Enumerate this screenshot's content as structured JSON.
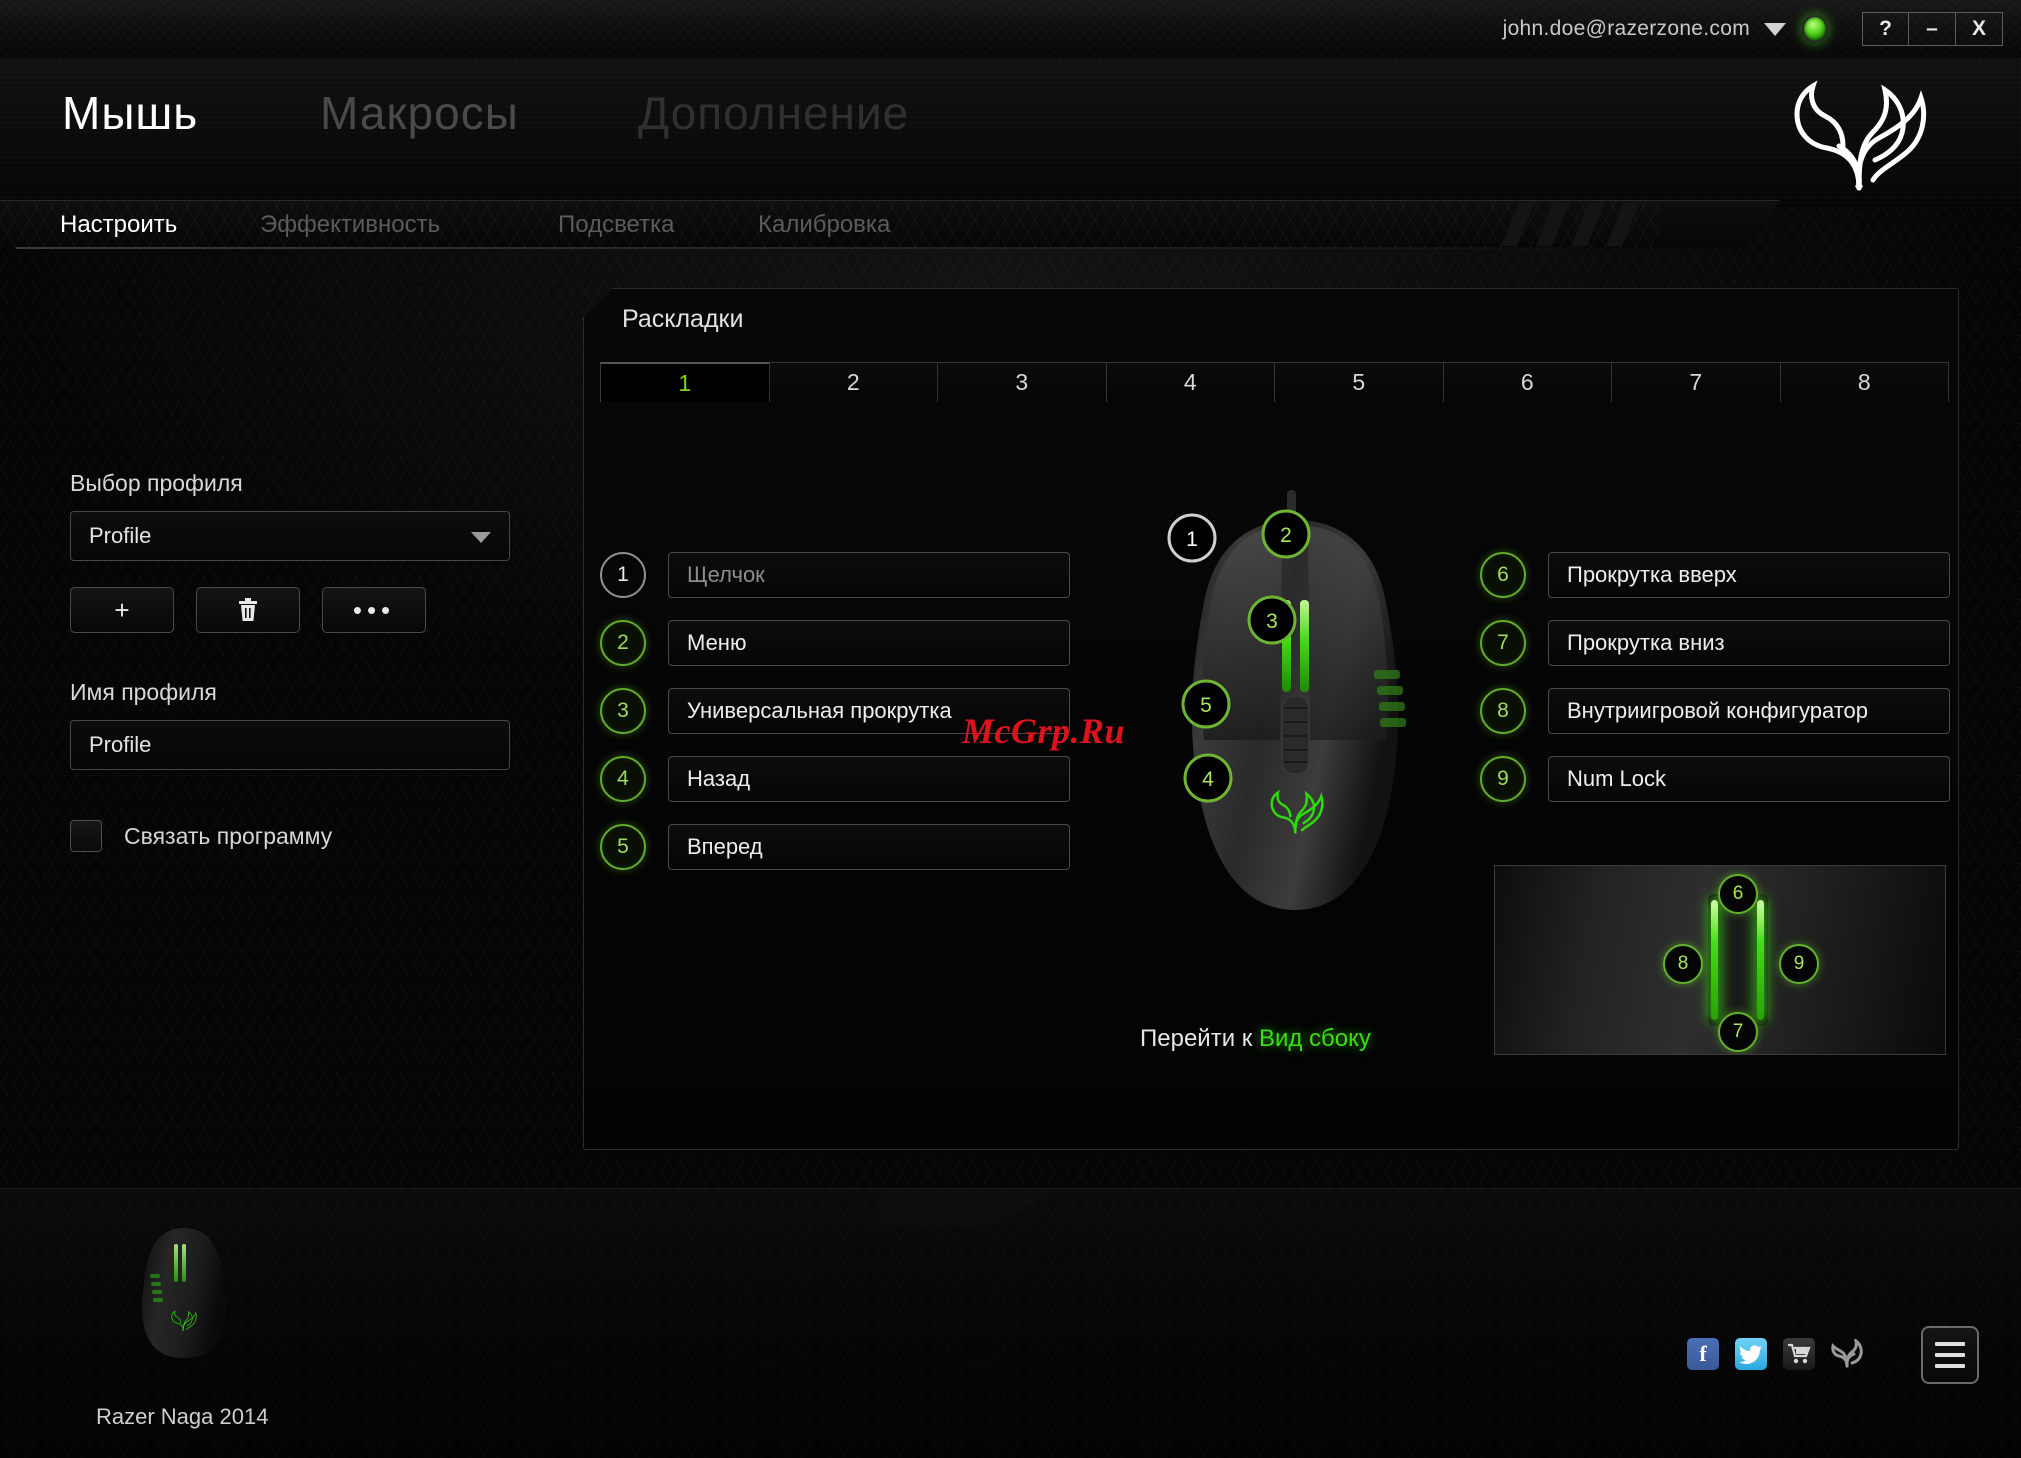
{
  "window": {
    "account_email": "john.doe@razerzone.com",
    "status_indicator": "online",
    "help_label": "?",
    "minimize_label": "–",
    "close_label": "X"
  },
  "main_tabs": [
    {
      "label": "Мышь",
      "active": true
    },
    {
      "label": "Макросы",
      "active": false
    },
    {
      "label": "Дополнение",
      "active": false
    }
  ],
  "sub_tabs": [
    {
      "label": "Настроить",
      "active": true
    },
    {
      "label": "Эффективность",
      "active": false
    },
    {
      "label": "Подсветка",
      "active": false
    },
    {
      "label": "Калибровка",
      "active": false
    }
  ],
  "sidebar": {
    "profile_select_label": "Выбор профиля",
    "profile_select_value": "Profile",
    "add_button": "+",
    "delete_button": "Ὕ1",
    "more_button": "•••",
    "profile_name_label": "Имя профиля",
    "profile_name_value": "Profile",
    "link_program_label": "Связать программу",
    "link_program_checked": false
  },
  "panel": {
    "title": "Раскладки",
    "number_tabs": [
      "1",
      "2",
      "3",
      "4",
      "5",
      "6",
      "7",
      "8"
    ],
    "active_number_tab": "1",
    "goto_prefix": "Перейти к",
    "goto_link": "Вид сбоку"
  },
  "assignments_left": [
    {
      "badge": "1",
      "value": "Щелчок",
      "style": "placeholder"
    },
    {
      "badge": "2",
      "value": "Меню",
      "style": "normal"
    },
    {
      "badge": "3",
      "value": "Универсальная прокрутка",
      "style": "normal"
    },
    {
      "badge": "4",
      "value": "Назад",
      "style": "normal"
    },
    {
      "badge": "5",
      "value": "Вперед",
      "style": "normal"
    }
  ],
  "assignments_right": [
    {
      "badge": "6",
      "value": "Прокрутка вверх",
      "style": "normal"
    },
    {
      "badge": "7",
      "value": "Прокрутка вниз",
      "style": "normal"
    },
    {
      "badge": "8",
      "value": "Внутриигровой конфигуратор",
      "style": "normal"
    },
    {
      "badge": "9",
      "value": "Num Lock",
      "style": "normal"
    }
  ],
  "mouse_callouts": [
    {
      "label": "1",
      "style": "gray"
    },
    {
      "label": "2",
      "style": "green"
    },
    {
      "label": "3",
      "style": "green"
    },
    {
      "label": "4",
      "style": "green"
    },
    {
      "label": "5",
      "style": "green"
    }
  ],
  "sideview_callouts": [
    {
      "label": "6"
    },
    {
      "label": "7"
    },
    {
      "label": "8"
    },
    {
      "label": "9"
    }
  ],
  "footer": {
    "device_name": "Razer Naga 2014",
    "facebook_label": "f",
    "twitter_label": "ᵕ",
    "cart_label": "🛒",
    "razer_label": "",
    "menu_label": "menu"
  },
  "watermark": "McGrp.Ru",
  "colors": {
    "accent_green": "#7ed321",
    "link_green": "#3bdd16",
    "text_primary": "#e8e8e8",
    "text_dim": "#5b5b5b",
    "watermark_red": "#e8141e"
  }
}
